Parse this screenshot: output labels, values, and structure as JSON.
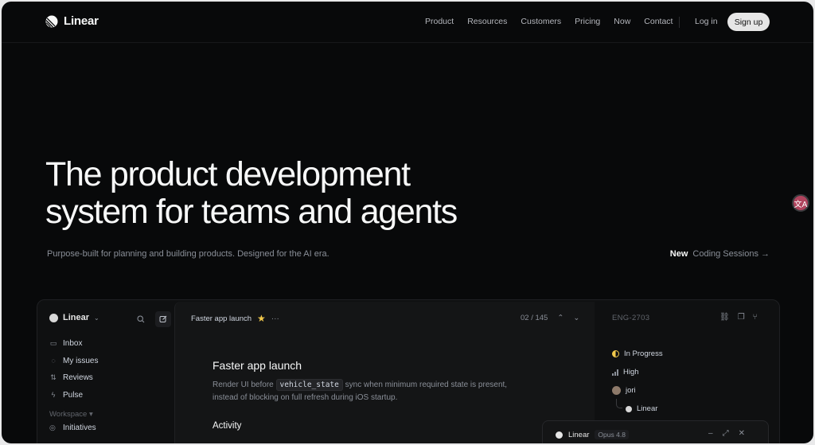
{
  "nav": {
    "brand": "Linear",
    "links": [
      "Product",
      "Resources",
      "Customers",
      "Pricing",
      "Now",
      "Contact"
    ],
    "login": "Log in",
    "signup": "Sign up"
  },
  "hero": {
    "title_line1": "The product development",
    "title_line2": "system for teams and agents",
    "subtitle": "Purpose-built for planning and building products. Designed for the AI era.",
    "new_badge": "New",
    "new_text": "Coding Sessions →"
  },
  "translate_fab": "文A",
  "app": {
    "workspace": "Linear",
    "sidebar_items": [
      {
        "icon": "inbox-icon",
        "glyph": "▭",
        "label": "Inbox"
      },
      {
        "icon": "my-issues-icon",
        "glyph": "◌",
        "label": "My issues"
      },
      {
        "icon": "reviews-icon",
        "glyph": "⇅",
        "label": "Reviews"
      },
      {
        "icon": "pulse-icon",
        "glyph": "ϟ",
        "label": "Pulse"
      }
    ],
    "section_label": "Workspace ▾",
    "section_item": "Initiatives",
    "issue": {
      "crumb": "Faster app launch",
      "pager": "02 / 145",
      "title": "Faster app launch",
      "desc_before": "Render UI before",
      "desc_code": "vehicle_state",
      "desc_after": "sync when minimum required state is present, instead of blocking on full refresh during iOS startup.",
      "activity": "Activity"
    },
    "details": {
      "id": "ENG-2703",
      "status": "In Progress",
      "priority": "High",
      "assignee": "jori",
      "team": "Linear"
    }
  },
  "agent": {
    "name": "Linear",
    "model": "Opus 4.8"
  },
  "colors": {
    "background": "#08090a",
    "accent_status": "#f2c94c",
    "signup_bg": "#e6e6e6"
  }
}
